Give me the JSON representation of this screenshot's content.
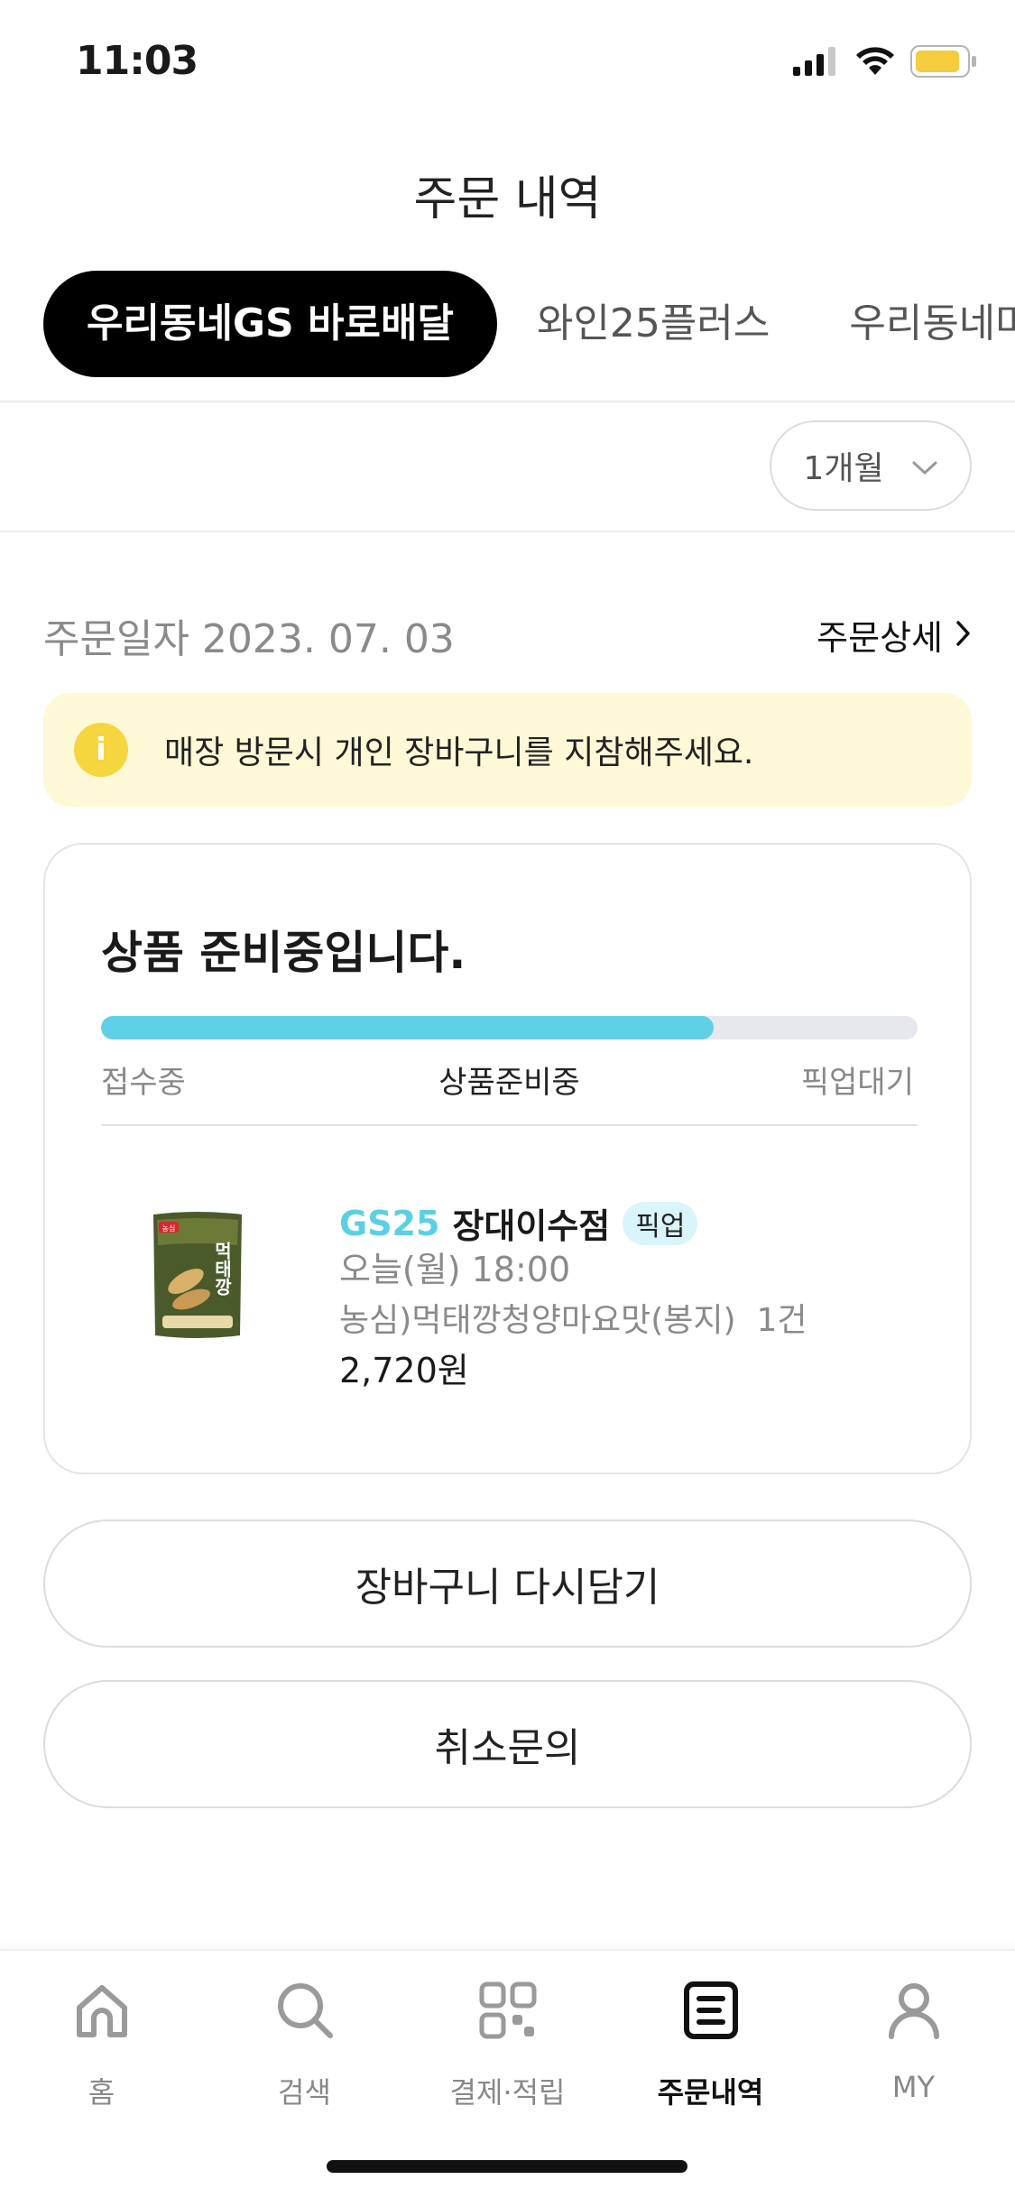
{
  "status_bar": {
    "time": "11:03",
    "icons": [
      "signal-icon",
      "wifi-icon",
      "battery-icon"
    ]
  },
  "header": {
    "title": "주문 내역"
  },
  "tabs": [
    {
      "label": "우리동네GS 바로배달",
      "active": true
    },
    {
      "label": "와인25플러스",
      "active": false
    },
    {
      "label": "우리동네마트",
      "active": false
    }
  ],
  "filter": {
    "period": "1개월"
  },
  "order": {
    "date": "주문일자 2023. 07. 03",
    "detail_link": "주문상세",
    "notice": "매장 방문시 개인 장바구니를 지참해주세요.",
    "notice_icon_glyph": "i",
    "status_title": "상품 준비중입니다.",
    "progress": {
      "fraction": 0.75,
      "steps": [
        "접수중",
        "상품준비중",
        "픽업대기"
      ],
      "current_step_index": 1
    },
    "store": {
      "brand": "GS25",
      "name": "장대이수점",
      "badge": "픽업"
    },
    "pickup_time": "오늘(월) 18:00",
    "product": {
      "name": "농심)먹태깡청양마요맛(봉지)",
      "quantity": "1건",
      "price": "2,720원",
      "image_text": "먹태깡",
      "image_brand": "농심"
    }
  },
  "actions": {
    "reorder_label": "장바구니 다시담기",
    "cancel_inquiry_label": "취소문의"
  },
  "bottom_nav": [
    {
      "label": "홈",
      "icon": "home-icon",
      "active": false
    },
    {
      "label": "검색",
      "icon": "search-icon",
      "active": false
    },
    {
      "label": "결제·적립",
      "icon": "payment-icon",
      "active": false
    },
    {
      "label": "주문내역",
      "icon": "order-history-icon",
      "active": true
    },
    {
      "label": "MY",
      "icon": "profile-icon",
      "active": false
    }
  ],
  "colors": {
    "accent": "#5fd0e6",
    "notice_bg": "#fdf8d6",
    "notice_icon": "#f5d63f",
    "battery": "#f5cd3c"
  }
}
